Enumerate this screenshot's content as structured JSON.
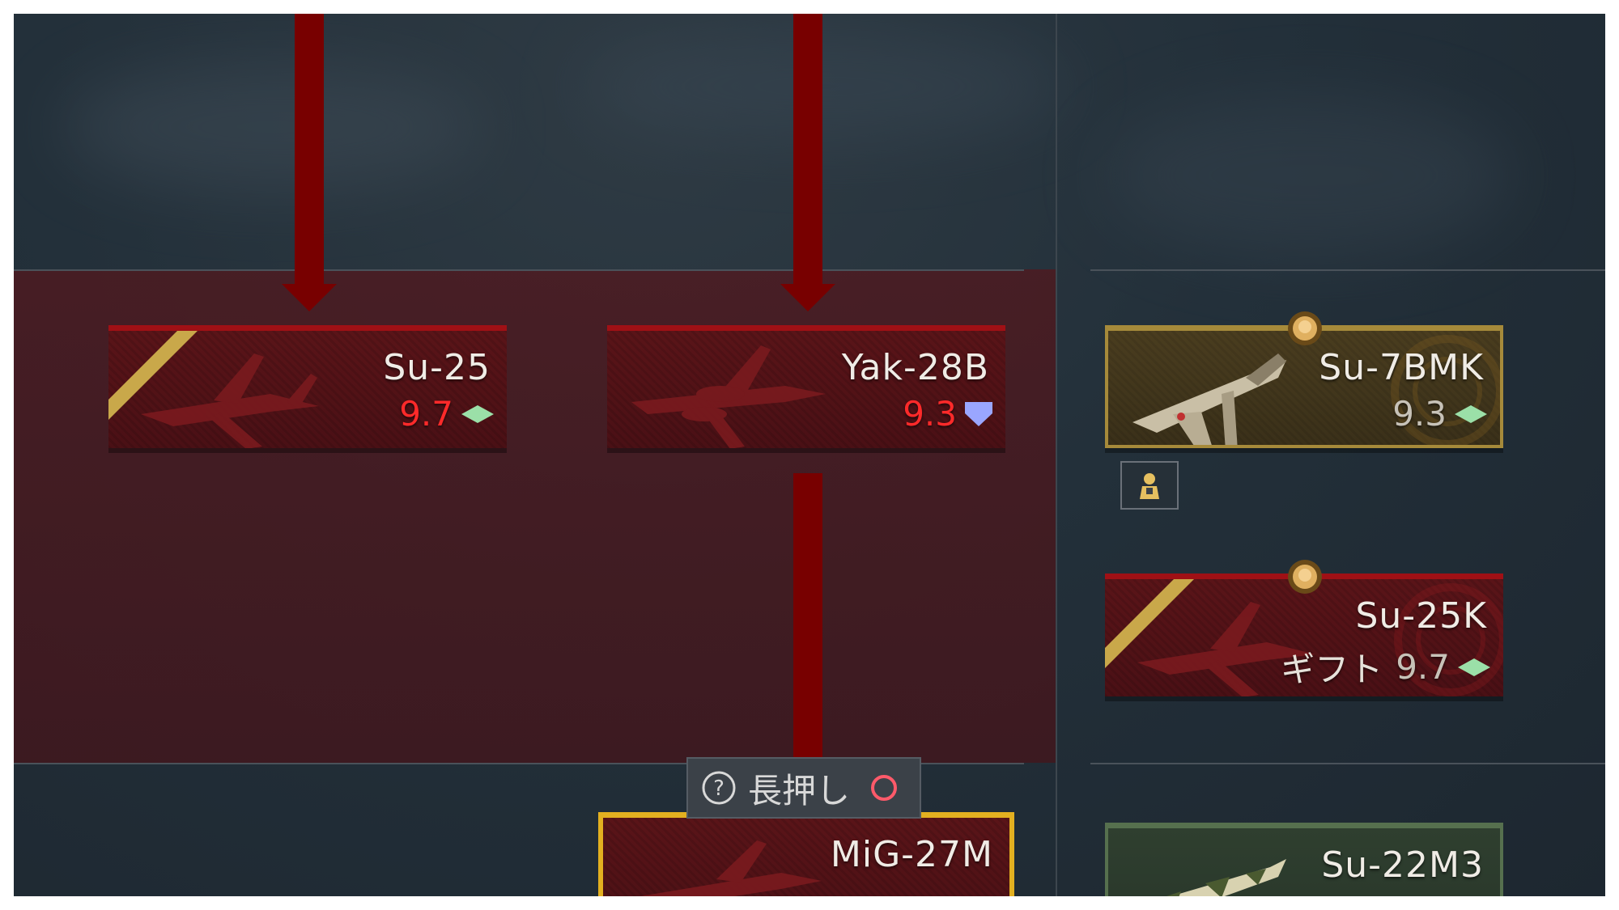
{
  "tree": {
    "vehicles": [
      {
        "name": "Su-25",
        "br": "9.7",
        "br_color": "#ff2a2a",
        "gift_label": "",
        "role_icon": "diamond-icon",
        "role_icon_color": "#9be0a8"
      },
      {
        "name": "Yak-28B",
        "br": "9.3",
        "br_color": "#ff2a2a",
        "gift_label": "",
        "role_icon": "shield-icon",
        "role_icon_color": "#9aa6ff"
      },
      {
        "name": "Su-7BMK",
        "br": "9.3",
        "br_color": "#c7c2b8",
        "gift_label": "",
        "role_icon": "diamond-icon",
        "role_icon_color": "#9be0a8"
      },
      {
        "name": "Su-25K",
        "br": "9.7",
        "br_color": "#c7c2b8",
        "gift_label": "ギフト",
        "role_icon": "diamond-icon",
        "role_icon_color": "#9be0a8"
      },
      {
        "name": "MiG-27M",
        "br": "",
        "br_color": "#ff2a2a",
        "gift_label": "",
        "role_icon": "",
        "role_icon_color": ""
      },
      {
        "name": "Su-22M3",
        "br": "",
        "br_color": "#c7c2b8",
        "gift_label": "",
        "role_icon": "",
        "role_icon_color": ""
      }
    ]
  },
  "tooltip": {
    "text": "長押し",
    "help_icon": "question-circle-icon",
    "button_icon": "circle-button-icon"
  },
  "colors": {
    "arrow": "#780000",
    "selected_border": "#e3b020",
    "research_card": "#5a1418",
    "premium_card": "#4a3d1f",
    "owned_card": "#2f3f2f"
  }
}
